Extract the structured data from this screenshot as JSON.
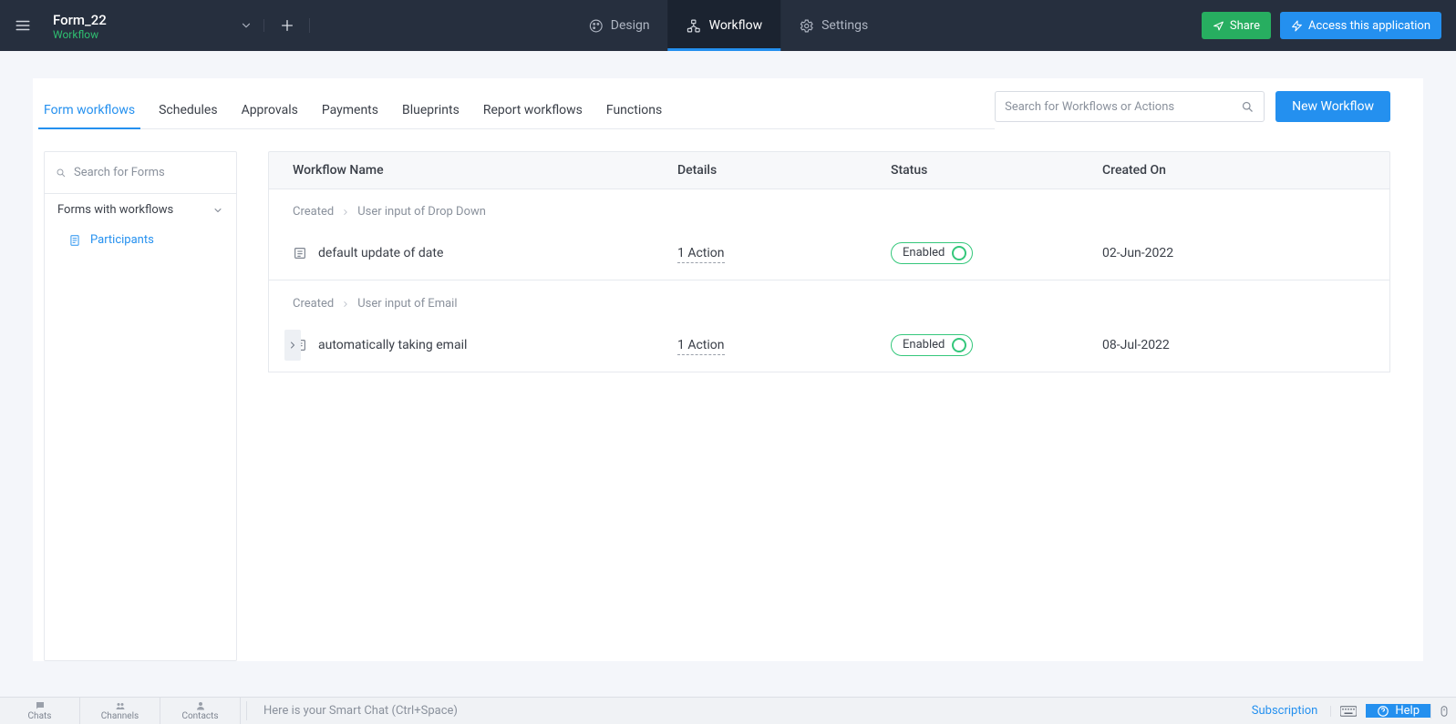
{
  "topbar": {
    "app_title": "Form_22",
    "app_sub": "Workflow",
    "tabs": {
      "design": "Design",
      "workflow": "Workflow",
      "settings": "Settings"
    },
    "share_label": "Share",
    "access_label": "Access this application"
  },
  "subtabs": {
    "form_workflows": "Form workflows",
    "schedules": "Schedules",
    "approvals": "Approvals",
    "payments": "Payments",
    "blueprints": "Blueprints",
    "report_workflows": "Report workflows",
    "functions": "Functions"
  },
  "search": {
    "workflows_placeholder": "Search for Workflows or Actions",
    "forms_placeholder": "Search for Forms"
  },
  "buttons": {
    "new_workflow": "New Workflow"
  },
  "forms_sidebar": {
    "group_label": "Forms with workflows",
    "items": {
      "participants": "Participants"
    }
  },
  "table": {
    "headers": {
      "name": "Workflow Name",
      "details": "Details",
      "status": "Status",
      "created": "Created On"
    },
    "groups": [
      {
        "crumb_a": "Created",
        "crumb_b": "User input of Drop Down",
        "row": {
          "name": "default update of date",
          "details": "1 Action",
          "status": "Enabled",
          "created": "02-Jun-2022"
        }
      },
      {
        "crumb_a": "Created",
        "crumb_b": "User input of Email",
        "row": {
          "name": "automatically taking email",
          "details": "1 Action",
          "status": "Enabled",
          "created": "08-Jul-2022"
        }
      }
    ]
  },
  "bottombar": {
    "chats": "Chats",
    "channels": "Channels",
    "contacts": "Contacts",
    "smart_chat": "Here is your Smart Chat (Ctrl+Space)",
    "subscription": "Subscription",
    "help": "Help"
  }
}
